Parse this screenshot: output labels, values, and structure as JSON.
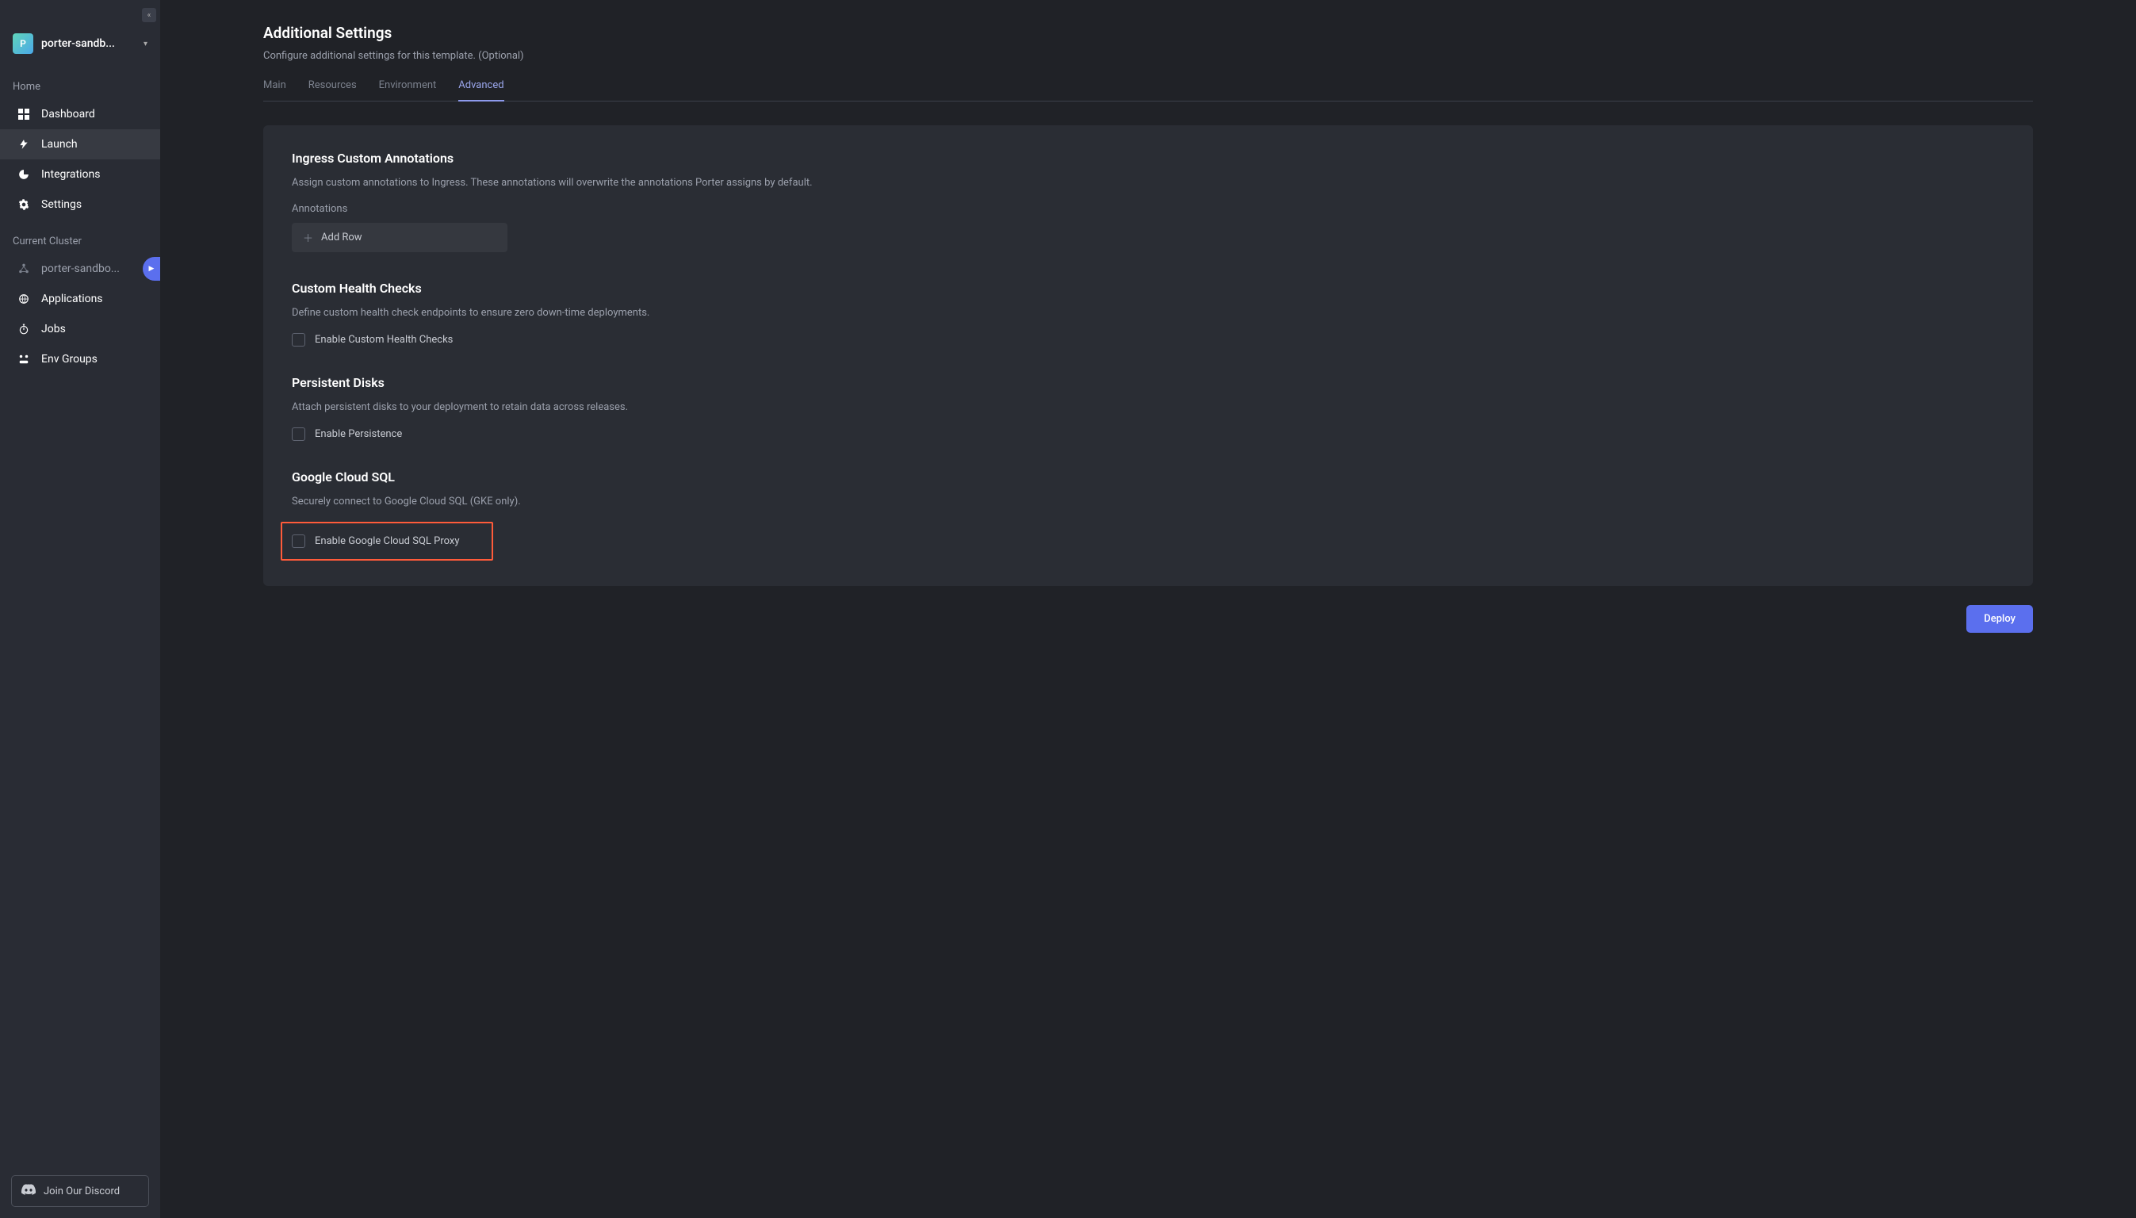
{
  "workspace": {
    "avatar_letter": "P",
    "name": "porter-sandb..."
  },
  "sidebar": {
    "home_label": "Home",
    "items": [
      {
        "label": "Dashboard"
      },
      {
        "label": "Launch"
      },
      {
        "label": "Integrations"
      },
      {
        "label": "Settings"
      }
    ],
    "cluster_label": "Current Cluster",
    "cluster_name": "porter-sandbo...",
    "cluster_items": [
      {
        "label": "Applications"
      },
      {
        "label": "Jobs"
      },
      {
        "label": "Env Groups"
      }
    ],
    "discord_label": "Join Our Discord"
  },
  "page": {
    "title": "Additional Settings",
    "subtitle": "Configure additional settings for this template. (Optional)"
  },
  "tabs": [
    {
      "label": "Main"
    },
    {
      "label": "Resources"
    },
    {
      "label": "Environment"
    },
    {
      "label": "Advanced"
    }
  ],
  "sections": {
    "ingress": {
      "title": "Ingress Custom Annotations",
      "desc": "Assign custom annotations to Ingress. These annotations will overwrite the annotations Porter assigns by default.",
      "field_label": "Annotations",
      "add_row_label": "Add Row"
    },
    "health": {
      "title": "Custom Health Checks",
      "desc": "Define custom health check endpoints to ensure zero down-time deployments.",
      "checkbox_label": "Enable Custom Health Checks"
    },
    "persist": {
      "title": "Persistent Disks",
      "desc": "Attach persistent disks to your deployment to retain data across releases.",
      "checkbox_label": "Enable Persistence"
    },
    "gcsql": {
      "title": "Google Cloud SQL",
      "desc": "Securely connect to Google Cloud SQL (GKE only).",
      "checkbox_label": "Enable Google Cloud SQL Proxy"
    }
  },
  "deploy_label": "Deploy"
}
